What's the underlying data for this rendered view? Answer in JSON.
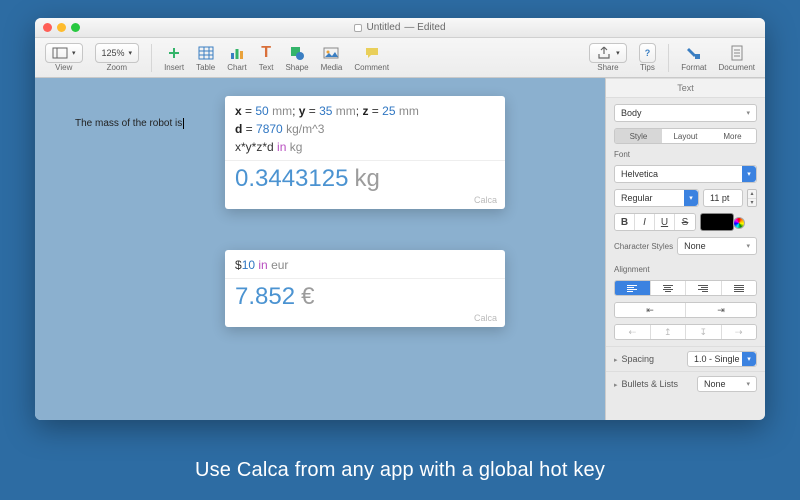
{
  "window": {
    "title": "Untitled",
    "edited": "Edited"
  },
  "toolbar": {
    "view": "View",
    "zoom_value": "125%",
    "zoom_label": "Zoom",
    "insert": "Insert",
    "table": "Table",
    "chart": "Chart",
    "text": "Text",
    "shape": "Shape",
    "media": "Media",
    "comment": "Comment",
    "share": "Share",
    "tips": "Tips",
    "format": "Format",
    "document": "Document"
  },
  "document": {
    "body_text": "The mass of the robot is"
  },
  "calca1": {
    "l1": {
      "x": "x",
      "eq": " = ",
      "xv": "50",
      "xu": " mm",
      "sep": "; ",
      "y": "y",
      "yv": "35",
      "yu": " mm",
      "z": "z",
      "zv": "25",
      "zu": " mm"
    },
    "l2": {
      "d": "d",
      "eq": " = ",
      "dv": "7870",
      "du": " kg/m^3"
    },
    "l3": {
      "expr": "x*y*z*d ",
      "kw": "in",
      "tail": " kg"
    },
    "result_value": "0.3443125",
    "result_unit": "kg",
    "brand": "Calca"
  },
  "calca2": {
    "expr_pre": "$",
    "expr_num": "10",
    "expr_mid": " ",
    "kw": "in",
    "expr_tail": " eur",
    "result_value": "7.852",
    "result_unit": "€",
    "brand": "Calca"
  },
  "inspector": {
    "tab_format": "Format",
    "tab_document": "Document",
    "header": "Text",
    "para_style": "Body",
    "seg_style": "Style",
    "seg_layout": "Layout",
    "seg_more": "More",
    "font_label": "Font",
    "font_family": "Helvetica",
    "font_weight": "Regular",
    "font_size": "11 pt",
    "b": "B",
    "i": "I",
    "u": "U",
    "s": "S",
    "char_styles_label": "Character Styles",
    "char_styles_value": "None",
    "align_label": "Alignment",
    "spacing_label": "Spacing",
    "spacing_value": "1.0 - Single",
    "bullets_label": "Bullets & Lists",
    "bullets_value": "None"
  },
  "caption": "Use Calca from any app with a global hot key"
}
